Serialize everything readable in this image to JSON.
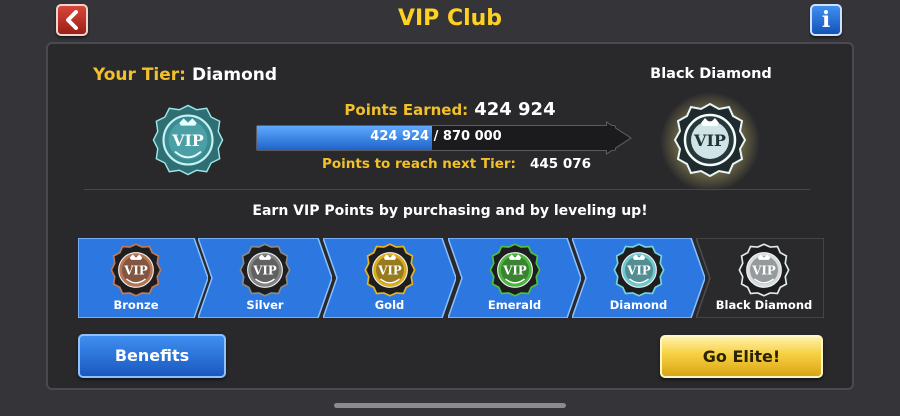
{
  "header": {
    "title": "VIP Club",
    "back_icon": "chevron-left-icon",
    "info_icon": "info-icon",
    "info_glyph": "i"
  },
  "status": {
    "your_tier_label": "Your Tier:",
    "your_tier_value": "Diamond",
    "next_tier_name": "Black Diamond",
    "points_earned_label": "Points Earned:",
    "points_earned_value": "424 924",
    "progress_current": "424 924",
    "progress_separator": " / ",
    "progress_target": "870 000",
    "progress_fraction": 0.488,
    "points_next_label": "Points to reach next Tier:",
    "points_next_value": "445 076"
  },
  "info": {
    "earn_text": "Earn VIP Points by purchasing and by leveling up!"
  },
  "tiers": [
    {
      "name": "Bronze",
      "badge_color": "#c07a55",
      "current": false
    },
    {
      "name": "Silver",
      "badge_color": "#8a8a8a",
      "current": false
    },
    {
      "name": "Gold",
      "badge_color": "#e6b51e",
      "current": false
    },
    {
      "name": "Emerald",
      "badge_color": "#4cc23c",
      "current": false
    },
    {
      "name": "Diamond",
      "badge_color": "#74d4d9",
      "current": true
    },
    {
      "name": "Black Diamond",
      "badge_color": "#dfe8ea",
      "current": false
    }
  ],
  "buttons": {
    "benefits": "Benefits",
    "go_elite": "Go Elite!"
  },
  "badge_text": "VIP",
  "colors": {
    "accent_yellow": "#f2c029",
    "tier_blue": "#2c78e0",
    "background": "#353539"
  }
}
